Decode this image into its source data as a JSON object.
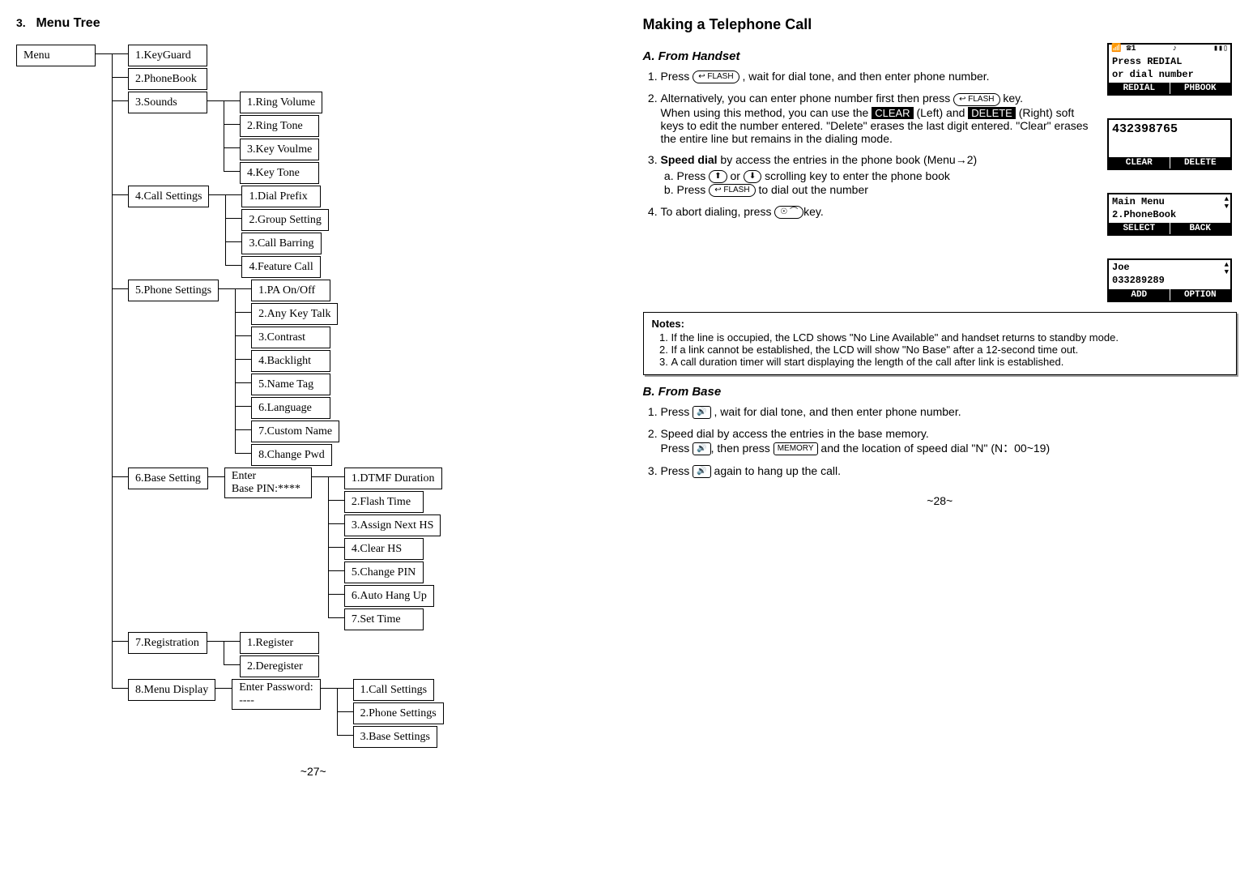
{
  "left": {
    "heading_num": "3.",
    "heading": "Menu Tree",
    "root": "Menu",
    "items": [
      {
        "label": "1.KeyGuard"
      },
      {
        "label": "2.PhoneBook"
      },
      {
        "label": "3.Sounds",
        "children": [
          "1.Ring Volume",
          "2.Ring Tone",
          "3.Key Voulme",
          "4.Key Tone"
        ]
      },
      {
        "label": "4.Call Settings",
        "children": [
          "1.Dial Prefix",
          "2.Group Setting",
          "3.Call Barring",
          "4.Feature Call"
        ]
      },
      {
        "label": "5.Phone Settings",
        "children": [
          "1.PA On/Off",
          "2.Any Key Talk",
          "3.Contrast",
          "4.Backlight",
          "5.Name Tag",
          "6.Language",
          "7.Custom  Name",
          "8.Change Pwd"
        ]
      },
      {
        "label": "6.Base Setting",
        "mid": {
          "line1": "Enter",
          "line2": "Base PIN:****"
        },
        "children": [
          "1.DTMF Duration",
          "2.Flash Time",
          "3.Assign Next HS",
          "4.Clear HS",
          "5.Change PIN",
          "6.Auto Hang Up",
          "7.Set Time"
        ]
      },
      {
        "label": "7.Registration",
        "children": [
          "1.Register",
          "2.Deregister"
        ]
      },
      {
        "label": "8.Menu Display",
        "mid": {
          "line1": "Enter Password:",
          "line2": "----"
        },
        "children": [
          "1.Call Settings",
          "2.Phone Settings",
          "3.Base Settings"
        ]
      }
    ],
    "pagenum": "~27~"
  },
  "right": {
    "title": "Making a Telephone Call",
    "sectionA": "A. From Handset",
    "step1": {
      "pre": "Press ",
      "key": "↩ FLASH",
      "post": " , wait for dial tone, and then enter phone number."
    },
    "step2": {
      "line1_pre": "Alternatively, you can enter phone number first then press ",
      "line1_key": "↩ FLASH",
      "line1_post": " key.",
      "line2_pre": "When using this method, you can use the ",
      "clear": "CLEAR",
      "mid1": " (Left) and ",
      "delete": "DELETE",
      "mid2": " (Right) soft keys to edit the number entered.  \"Delete\" erases the last digit entered.  \"Clear\" erases the entire line but remains in the dialing mode."
    },
    "step3": {
      "bold": "Speed dial",
      "rest": " by access the entries in the phone book (Menu",
      "arrow": "→",
      "rest2": "2)",
      "a_pre": "Press ",
      "a_key1": "⬆",
      "a_mid": " or ",
      "a_key2": "⬇",
      "a_post": " scrolling key to enter the phone book",
      "b_pre": "Press ",
      "b_key": "↩ FLASH",
      "b_post": " to dial out the number"
    },
    "step4": {
      "pre": "To abort dialing, press ",
      "key": "☉ ⌒",
      "post": "key."
    },
    "notes_title": "Notes:",
    "notes": [
      "If the line is occupied, the LCD shows \"No Line Available\" and handset returns to standby mode.",
      "If a link cannot be established, the LCD will show \"No Base\" after a 12-second time out.",
      "A call duration timer will start displaying the length of the call after link is established."
    ],
    "sectionB": "B. From Base",
    "b1_pre": "Press ",
    "b1_key": "🔊",
    "b1_post": " , wait for dial tone, and then enter phone number.",
    "b2_pre": "Speed dial by access the entries in the base memory.",
    "b2b_pre": "Press ",
    "b2b_key1": "🔊",
    "b2b_mid": ", then press ",
    "b2b_key2": "MEMORY",
    "b2b_post": " and the location of speed dial \"N\" (N：00~19)",
    "b3_pre": "Press ",
    "b3_key": "🔊",
    "b3_post": " again to hang up the call.",
    "lcd1": {
      "status_left": "📶 ☎1",
      "status_mid": "♪",
      "status_right": "▮▮▯",
      "line1": "Press REDIAL",
      "line2": "or dial number",
      "soft_left": "REDIAL",
      "soft_right": "PHBOOK"
    },
    "lcd2": {
      "line1": "432398765",
      "soft_left": "CLEAR",
      "soft_right": "DELETE"
    },
    "lcd3": {
      "line1": "Main Menu",
      "line2": "2.PhoneBook",
      "soft_left": "SELECT",
      "soft_right": "BACK"
    },
    "lcd4": {
      "line1": "Joe",
      "line2": "033289289",
      "soft_left": "ADD",
      "soft_right": "OPTION"
    },
    "pagenum": "~28~"
  }
}
